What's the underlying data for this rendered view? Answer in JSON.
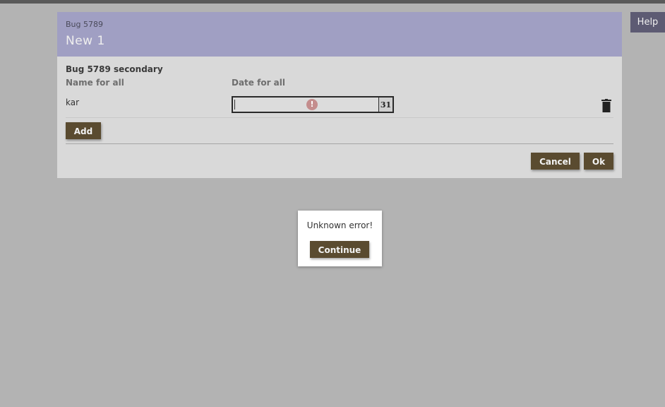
{
  "help": {
    "label": "Help"
  },
  "dialog": {
    "subtitle": "Bug 5789",
    "title": "New 1",
    "section_title": "Bug 5789 secondary",
    "columns": {
      "name": "Name for all",
      "date": "Date for all"
    },
    "row": {
      "name": "kar",
      "date_value": "",
      "calendar_label": "31"
    },
    "add_label": "Add",
    "cancel_label": "Cancel",
    "ok_label": "Ok"
  },
  "alert": {
    "message": "Unknown error!",
    "continue_label": "Continue"
  },
  "icons": {
    "error": "exclamation-circle-icon",
    "calendar": "calendar-icon",
    "trash": "trash-icon"
  },
  "colors": {
    "background": "#b3b3b3",
    "header": "#a09fc3",
    "button": "#5a4b30",
    "help": "#5d5b73",
    "error_icon": "#c48d8d"
  }
}
